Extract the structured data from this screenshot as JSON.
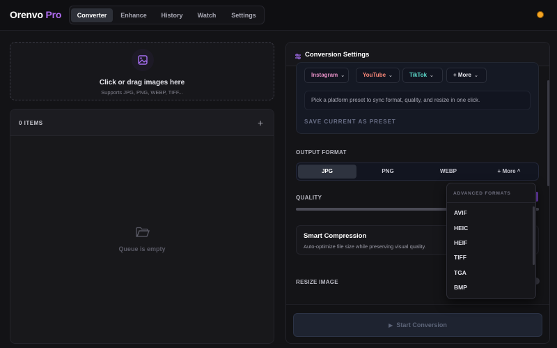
{
  "app": {
    "name": "Orenvo",
    "badge": "Pro"
  },
  "nav": {
    "tabs": [
      "Converter",
      "Enhance",
      "History",
      "Watch",
      "Settings"
    ],
    "active": "Converter"
  },
  "dropzone": {
    "title": "Click or drag images here",
    "subtitle": "Supports JPG, PNG, WEBP, TIFF..."
  },
  "queue": {
    "count_label": "0 ITEMS",
    "empty_label": "Queue is empty"
  },
  "settings": {
    "title": "Conversion Settings",
    "presets": [
      {
        "label": "Instagram",
        "color": "#e48fc4"
      },
      {
        "label": "YouTube",
        "color": "#ff8a7a"
      },
      {
        "label": "TikTok",
        "color": "#5ee0d0"
      },
      {
        "label": "+ More",
        "color": "#e8e8ee"
      }
    ],
    "preset_hint": "Pick a platform preset to sync format, quality, and resize in one click.",
    "save_preset": "SAVE CURRENT AS PRESET",
    "output_format_label": "OUTPUT FORMAT",
    "formats": [
      "JPG",
      "PNG",
      "WEBP",
      "+ More ^"
    ],
    "selected_format": "JPG",
    "quality_label": "QUALITY",
    "smart": {
      "title": "Smart Compression",
      "subtitle": "Auto-optimize file size while preserving visual quality."
    },
    "resize_label": "RESIZE IMAGE",
    "start_button": "Start Conversion"
  },
  "advanced_dropdown": {
    "header": "ADVANCED FORMATS",
    "items": [
      "AVIF",
      "HEIC",
      "HEIF",
      "TIFF",
      "TGA",
      "BMP"
    ]
  },
  "colors": {
    "accent": "#b06cf0",
    "background": "#131316",
    "panel": "#141417"
  }
}
